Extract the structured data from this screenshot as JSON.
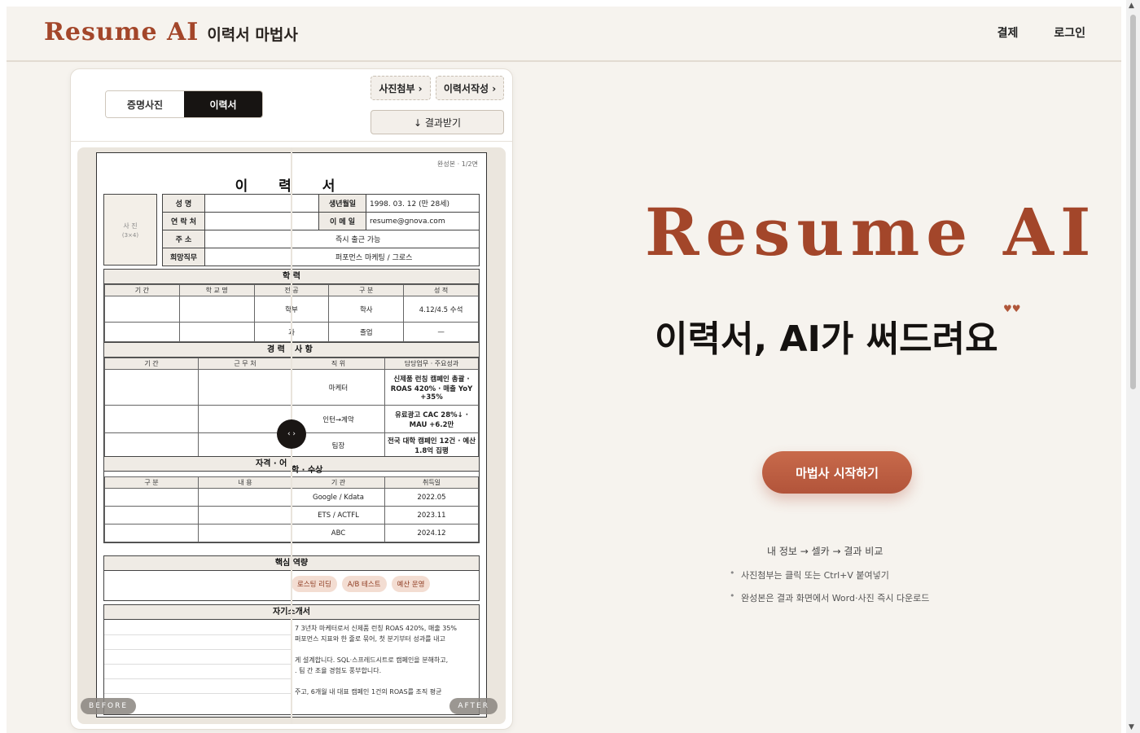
{
  "header": {
    "brand_en": "Resume AI",
    "brand_ko": "이력서 마법사",
    "nav": [
      "결제",
      "로그인"
    ]
  },
  "card": {
    "tabs": [
      "증명사진",
      "이력서"
    ],
    "active_tab": "이력서",
    "step_photo": "사진첨부 ›",
    "step_resume": "이력서작성 ›",
    "result_button": "↓ 결과받기",
    "compare_labels": {
      "before": "BEFORE",
      "after": "AFTER"
    }
  },
  "resume": {
    "page_info": "완성본 · 1/2면",
    "title": "이 력 서",
    "photo_label": "사 진",
    "photo_size": "(3×4)",
    "info": {
      "name_label": "성 명",
      "contact_label": "연 락 처",
      "address_label": "주 소",
      "job_label": "희망직무",
      "birth_label": "생년월일",
      "birth_value": "1998. 03. 12 (만 28세)",
      "email_label": "이 메 일",
      "email_value": "resume@gnova.com",
      "address_value": "즉시 출근 가능",
      "job_value": "퍼포먼스 마케팅 / 그로스"
    },
    "education": {
      "head": "학 력",
      "cols": [
        "기 간",
        "학 교 명",
        "전 공",
        "구 분",
        "성 적"
      ],
      "rows": [
        [
          "",
          "",
          "학부",
          "학사",
          "4.12/4.5 수석"
        ],
        [
          "",
          "",
          "과",
          "졸업",
          "—"
        ]
      ]
    },
    "career": {
      "head": "경 력",
      "head_right": "사 항",
      "cols": [
        "기 간",
        "근 무 처",
        "직 위",
        "담당업무 · 주요성과"
      ],
      "rows": [
        [
          "",
          "",
          "마케터",
          "신제품 런칭 캠페인 총괄 · ROAS 420% · 매출 YoY +35%"
        ],
        [
          "",
          "",
          "인턴→계약",
          "유료광고 CAC 28%↓ · MAU +6.2만"
        ],
        [
          "",
          "",
          "팀장",
          "전국 대학 캠페인 12건 · 예산 1.8억 집행"
        ]
      ]
    },
    "license": {
      "head": "자격 · 어",
      "head_right": "학 · 수상",
      "cols": [
        "구 분",
        "내 용",
        "기 관",
        "취득일"
      ],
      "rows": [
        [
          "",
          "",
          "Google / Kdata",
          "2022.05"
        ],
        [
          "",
          "",
          "ETS / ACTFL",
          "2023.11"
        ],
        [
          "",
          "",
          "ABC",
          "2024.12"
        ]
      ]
    },
    "skills": {
      "head": "핵심 역량",
      "chips": [
        "로스팅 리딩",
        "A/B 테스트",
        "예산 운영"
      ]
    },
    "intro": {
      "head": "자기소개서",
      "lines": [
        "7 3년차 마케터로서 신제품 런칭 ROAS 420%, 매출 35%",
        "퍼포먼스 지표와 한 줄로 묶어, 첫 분기부터 성과를 내고",
        "",
        "게 설계합니다. SQL·스프레드시트로 캠페인을 분해하고,",
        ". 팀 간 조율 경험도 풍부합니다.",
        "",
        "주고, 6개월 내 대표 캠페인 1건의 ROAS를 조직 평균"
      ]
    }
  },
  "hero": {
    "title": "Resume AI",
    "subtitle": "이력서, AI가 써드려요",
    "cta": "마법사 시작하기",
    "flow": "내 정보 → 셀카 → 결과 비교",
    "tips": [
      "사진첨부는 클릭 또는 Ctrl+V 붙여넣기",
      "완성본은 결과 화면에서 Word·사진 즉시 다운로드"
    ]
  },
  "colors": {
    "brand": "#a3462a",
    "cta": "#bb5d40",
    "bg": "#f6f3ee"
  }
}
